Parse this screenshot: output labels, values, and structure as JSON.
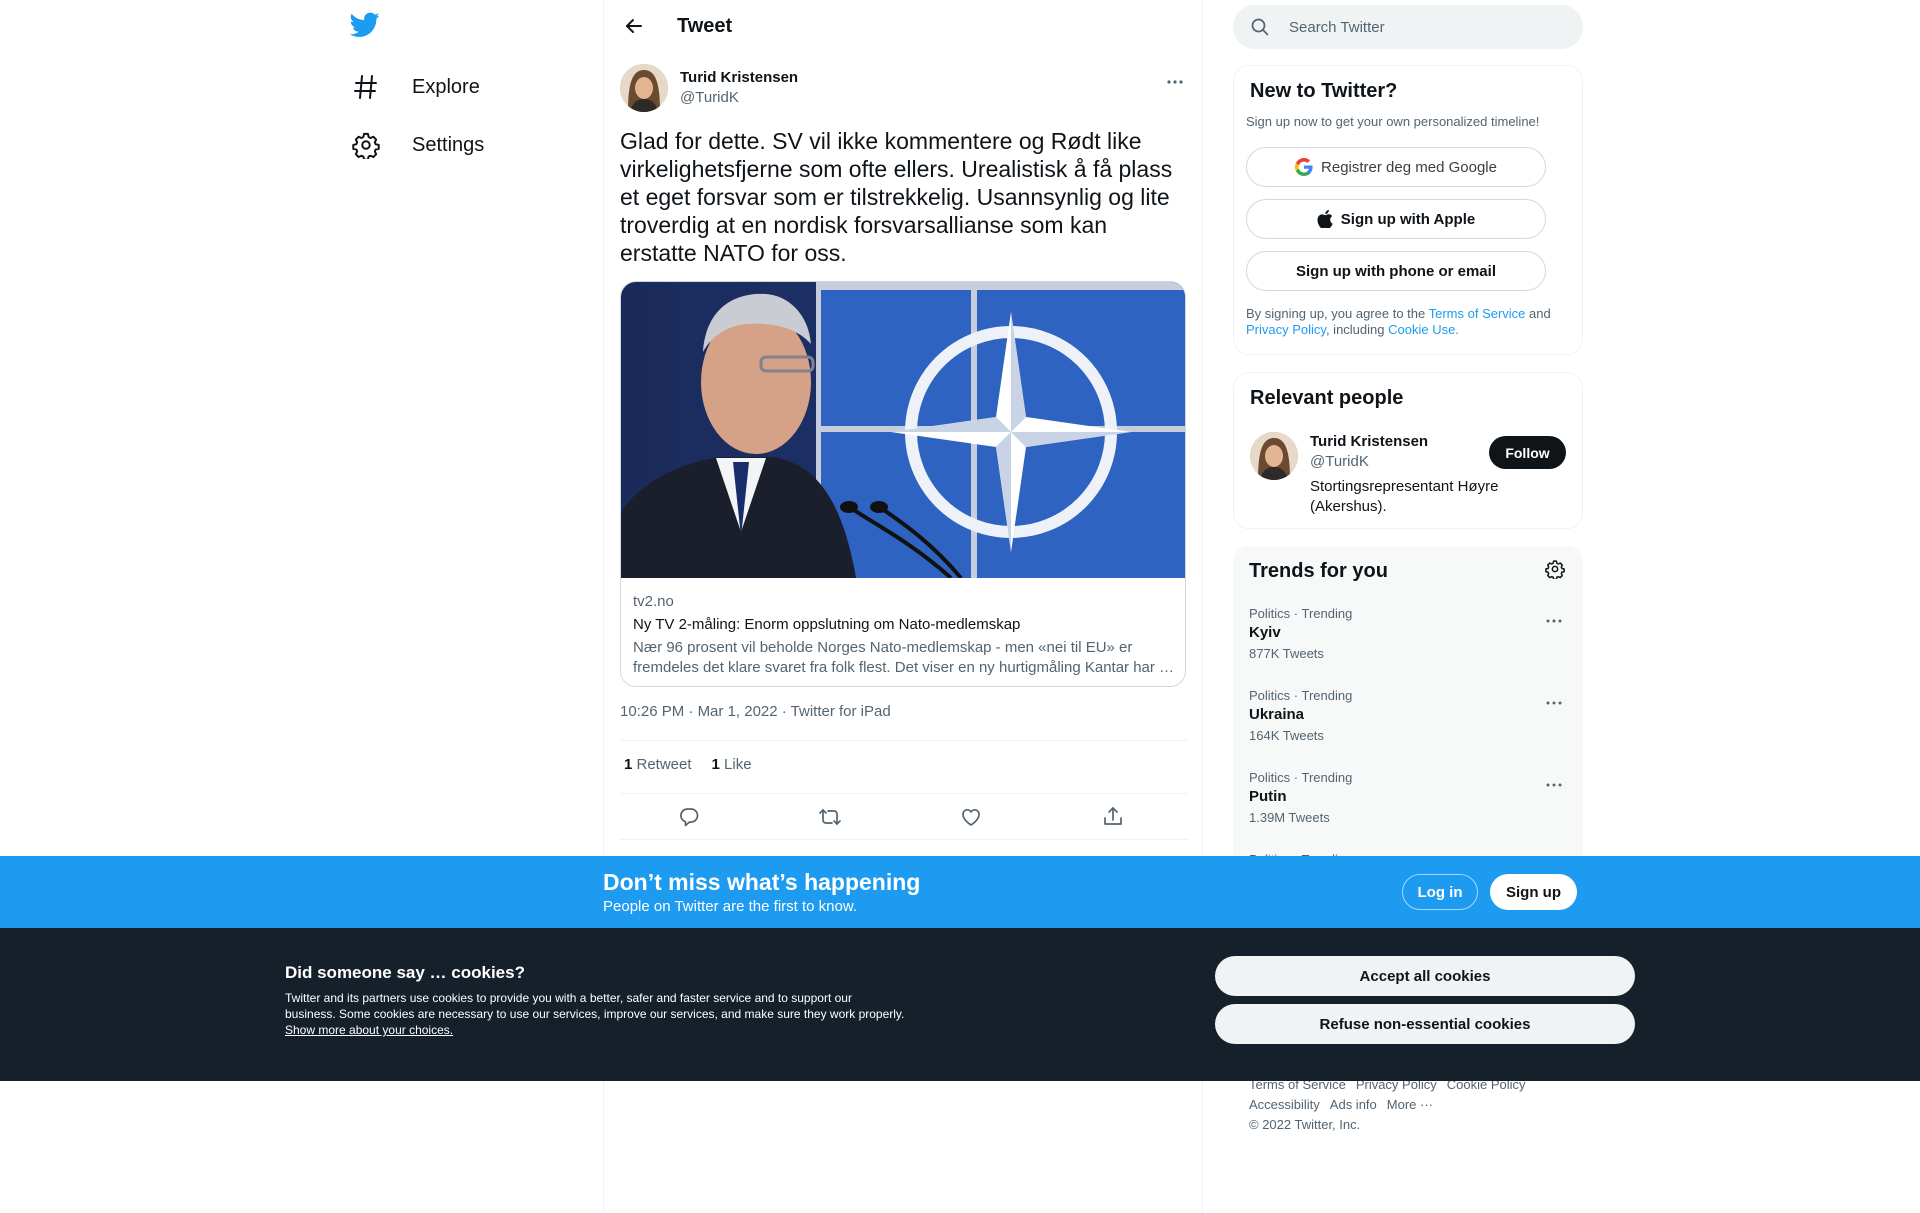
{
  "nav": {
    "items": [
      {
        "label": "Explore"
      },
      {
        "label": "Settings"
      }
    ]
  },
  "header": {
    "title": "Tweet"
  },
  "tweet": {
    "author_name": "Turid Kristensen",
    "author_handle": "@TuridK",
    "text": "Glad for dette. SV vil ikke kommentere og Rødt like virkelighetsfjerne som ofte ellers. Urealistisk å få plass et eget forsvar som er tilstrekkelig. Usannsynlig og lite troverdig at en nordisk forsvarsallianse som kan erstatte NATO for oss.",
    "card": {
      "domain": "tv2.no",
      "title": "Ny TV 2-måling: Enorm oppslutning om Nato-medlemskap",
      "description": "Nær 96 prosent vil beholde Norges Nato-medlemskap - men «nei til EU» er fremdeles det klare svaret fra folk flest. Det viser en ny hurtigmåling Kantar har …"
    },
    "time": "10:26 PM",
    "sep1": " · ",
    "date": "Mar 1, 2022",
    "sep2": " · ",
    "source": "Twitter for iPad",
    "retweet_count": "1",
    "retweet_label": " Retweet",
    "like_count": "1",
    "like_label": " Like"
  },
  "search": {
    "placeholder": "Search Twitter"
  },
  "new_to_twitter": {
    "title": "New to Twitter?",
    "subtitle": "Sign up now to get your own personalized timeline!",
    "google_label": "Registrer deg med Google",
    "apple_label": "Sign up with Apple",
    "phone_label": "Sign up with phone or email",
    "legal_prefix": "By signing up, you agree to the ",
    "terms_link": "Terms of Service",
    "legal_and": " and ",
    "privacy_link": "Privacy Policy",
    "legal_including": ", including ",
    "cookie_link": "Cookie Use."
  },
  "relevant_people": {
    "title": "Relevant people",
    "name": "Turid Kristensen",
    "handle": "@TuridK",
    "bio": "Stortingsrepresentant Høyre (Akershus).",
    "follow_label": "Follow"
  },
  "trends": {
    "title": "Trends for you",
    "items": [
      {
        "meta": "Politics · Trending",
        "name": "Kyiv",
        "count": "877K Tweets"
      },
      {
        "meta": "Politics · Trending",
        "name": "Ukraina",
        "count": "164K Tweets"
      },
      {
        "meta": "Politics · Trending",
        "name": "Putin",
        "count": "1.39M Tweets"
      },
      {
        "meta": "Politics · Trending",
        "name": "",
        "count": ""
      }
    ]
  },
  "footer": {
    "terms": "Terms of Service",
    "privacy": "Privacy Policy",
    "cookie": "Cookie Policy",
    "accessibility": "Accessibility",
    "ads": "Ads info",
    "more": "More ···",
    "copyright": "© 2022 Twitter, Inc."
  },
  "banner": {
    "title": "Don’t miss what’s happening",
    "subtitle": "People on Twitter are the first to know.",
    "login_label": "Log in",
    "signup_label": "Sign up"
  },
  "cookies": {
    "title": "Did someone say … cookies?",
    "text": "Twitter and its partners use cookies to provide you with a better, safer and faster service and to support our business. Some cookies are necessary to use our services, improve our services, and make sure they work properly. ",
    "link": "Show more about your choices.",
    "accept_label": "Accept all cookies",
    "refuse_label": "Refuse non-essential cookies"
  },
  "colors": {
    "brand": "#1d9bf0",
    "text_primary": "#0f1419",
    "text_secondary": "#536471",
    "cookie_bg": "#16202a"
  },
  "icons": {
    "logo": "twitter-bird-icon",
    "explore": "hashtag-icon",
    "settings": "gear-icon",
    "back": "arrow-left-icon",
    "more": "more-dots-icon",
    "reply": "reply-icon",
    "retweet": "retweet-icon",
    "like": "heart-icon",
    "share": "share-icon",
    "search": "search-icon",
    "google": "google-icon",
    "apple": "apple-icon"
  }
}
